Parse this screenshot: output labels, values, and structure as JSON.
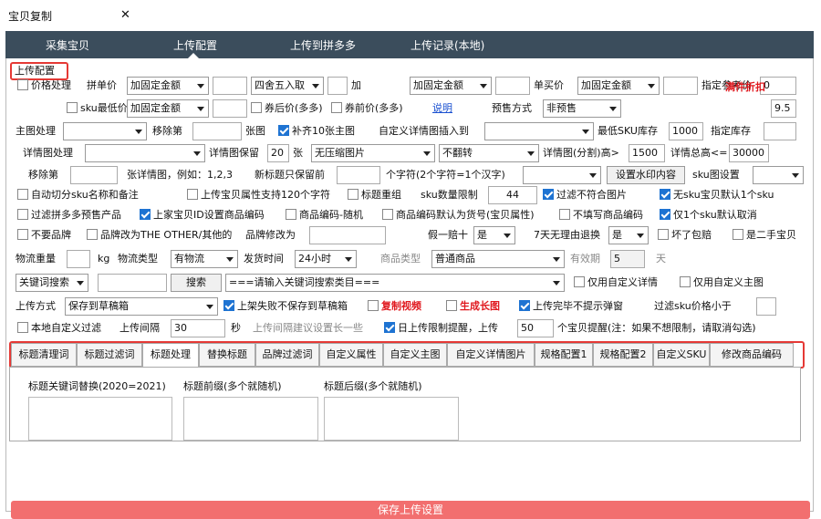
{
  "window_tab": {
    "title": "宝贝复制",
    "close": "✕"
  },
  "nav": [
    "采集宝贝",
    "上传配置",
    "上传到拼多多",
    "上传记录(本地)"
  ],
  "section_title": "上传配置",
  "r1": {
    "price_handle": "价格处理",
    "group_price": "拼单价",
    "sel1": "加固定金额",
    "sel2": "四舍五入取",
    "plus": "加",
    "sel3": "加固定金额",
    "single_price": "单买价",
    "sel4": "加固定金额",
    "ref_price": "指定参考价",
    "ref_val": "0",
    "discount": "满件折扣"
  },
  "r2": {
    "sku_min": "sku最低价",
    "sel1": "加固定金额",
    "coupon_after": "券后价(多多)",
    "coupon_before": "券前价(多多)",
    "explain": "说明",
    "presale": "预售方式",
    "presale_sel": "非预售",
    "discount_val": "9.5"
  },
  "r3": {
    "main_img": "主图处理",
    "remove": "移除第",
    "nth_img": "张图",
    "fill10": "补齐10张主图",
    "custom_detail": "自定义详情图插入到",
    "min_sku": "最低SKU库存",
    "min_sku_val": "1000",
    "stock": "指定库存"
  },
  "r4": {
    "detail_img": "详情图处理",
    "keep": "详情图保留",
    "keep_val": "20",
    "zhang": "张",
    "sel1": "无压缩图片",
    "sel2": "不翻转",
    "split_h": "详情图(分割)高>",
    "split_val": "1500",
    "total_h": "详情总高<=",
    "total_val": "30000"
  },
  "r5": {
    "remove": "移除第",
    "example": "张详情图，例如：1,2,3",
    "new_title": "新标题只保留前",
    "chars": "个字符(2个字符=1个汉字)",
    "watermark": "设置水印内容",
    "sku_img": "sku图设置"
  },
  "r6": {
    "auto_split": "自动切分sku名称和备注",
    "title_120": "上传宝贝属性支持120个字符",
    "title_regroup": "标题重组",
    "sku_limit": "sku数量限制",
    "sku_limit_val": "44",
    "filter_img": "过滤不符合图片",
    "no_sku": "无sku宝贝默认1个sku"
  },
  "r7": {
    "filter_presale": "过滤拼多多预售产品",
    "shop_id": "上家宝贝ID设置商品编码",
    "code_random": "商品编码-随机",
    "code_default": "商品编码默认为货号(宝贝属性)",
    "no_fill": "不填写商品编码",
    "only1": "仅1个sku默认取消"
  },
  "r8": {
    "no_brand": "不要品牌",
    "brand_other": "品牌改为THE OTHER/其他的",
    "brand_change": "品牌修改为",
    "fake": "假一赔十",
    "fake_sel": "是",
    "seven": "7天无理由退换",
    "seven_sel": "是",
    "broken": "坏了包赔",
    "second": "是二手宝贝"
  },
  "r9": {
    "weight": "物流重量",
    "kg": "kg",
    "logistics": "物流类型",
    "log_sel": "有物流",
    "ship": "发货时间",
    "ship_sel": "24小时",
    "goods_type": "商品类型",
    "goods_sel": "普通商品",
    "valid": "有效期",
    "valid_val": "5",
    "day": "天"
  },
  "r10": {
    "kw_sel": "关键词搜索",
    "search": "搜索",
    "cat_sel": "===请输入关键词搜索类目===",
    "custom_detail": "仅用自定义详情",
    "custom_main": "仅用自定义主图"
  },
  "r11": {
    "upload_mode": "上传方式",
    "mode_sel": "保存到草稿箱",
    "no_save": "上架失败不保存到草稿箱",
    "copy_video": "复制视频",
    "long_img": "生成长图",
    "no_popup": "上传完毕不提示弹窗",
    "filter_sku": "过滤sku价格小于"
  },
  "r12": {
    "local_filter": "本地自定义过滤",
    "interval": "上传间隔",
    "interval_val": "30",
    "sec": "秒",
    "hint": "上传间隔建议设置长一些",
    "daily": "日上传限制提醒，上传",
    "daily_val": "50",
    "daily_note": "个宝贝提醒(注：如果不想限制，请取消勾选)"
  },
  "tabs": [
    "标题清理词",
    "标题过滤词",
    "标题处理",
    "替换标题",
    "品牌过滤词",
    "自定义属性",
    "自定义主图",
    "自定义详情图片",
    "规格配置1",
    "规格配置2",
    "自定义SKU",
    "修改商品编码"
  ],
  "content": {
    "replace": "标题关键词替换(2020=2021)",
    "prefix": "标题前缀(多个就随机)",
    "suffix": "标题后缀(多个就随机)"
  },
  "save_btn": "保存上传设置",
  "colors": {
    "nav": "#3b4d5c",
    "accent_red": "#e53935",
    "check_blue": "#1e73d2",
    "save": "#f26f6f"
  }
}
